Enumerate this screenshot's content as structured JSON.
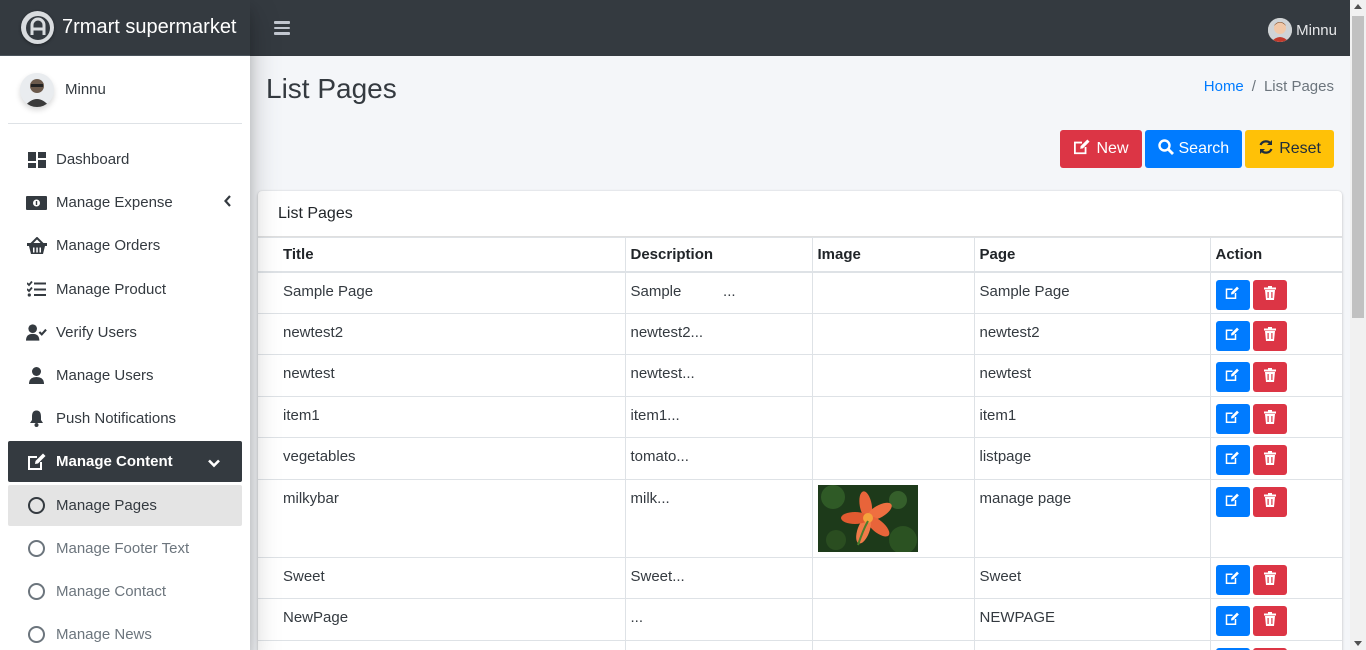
{
  "brand": {
    "name": "7rmart supermarket",
    "logo_icon": "app-logo-icon"
  },
  "sidebar": {
    "user_name": "Minnu",
    "items": [
      {
        "label": "Dashboard",
        "icon": "dashboard-icon"
      },
      {
        "label": "Manage Expense",
        "icon": "money-icon"
      },
      {
        "label": "Manage Orders",
        "icon": "basket-icon"
      },
      {
        "label": "Manage Product",
        "icon": "tasks-icon"
      },
      {
        "label": "Verify Users",
        "icon": "user-check-icon"
      },
      {
        "label": "Manage Users",
        "icon": "user-icon"
      },
      {
        "label": "Push Notifications",
        "icon": "bell-icon"
      },
      {
        "label": "Manage Content",
        "icon": "edit-icon"
      },
      {
        "label": "Manage Pages",
        "icon": "circle-icon"
      },
      {
        "label": "Manage Footer Text",
        "icon": "circle-icon"
      },
      {
        "label": "Manage Contact",
        "icon": "circle-icon"
      },
      {
        "label": "Manage News",
        "icon": "circle-icon"
      }
    ]
  },
  "topbar": {
    "user_name": "Minnu"
  },
  "page": {
    "title": "List Pages",
    "breadcrumb": {
      "home": "Home",
      "separator": "/",
      "current": "List Pages"
    }
  },
  "buttons": {
    "new": "New",
    "search": "Search",
    "reset": "Reset"
  },
  "card": {
    "title": "List Pages",
    "columns": [
      "Title",
      "Description",
      "Image",
      "Page",
      "Action"
    ],
    "rows": [
      {
        "title": "Sample Page",
        "description": "Sample          ...",
        "image": "",
        "page": "Sample Page"
      },
      {
        "title": "newtest2",
        "description": "newtest2...",
        "image": "",
        "page": "newtest2"
      },
      {
        "title": "newtest",
        "description": "newtest...",
        "image": "",
        "page": "newtest"
      },
      {
        "title": "item1",
        "description": "item1...",
        "image": "",
        "page": "item1"
      },
      {
        "title": "vegetables",
        "description": "tomato...",
        "image": "",
        "page": "listpage"
      },
      {
        "title": "milkybar",
        "description": "milk...",
        "image": "flower-thumbnail",
        "page": "manage page"
      },
      {
        "title": "Sweet",
        "description": "Sweet...",
        "image": "",
        "page": "Sweet"
      },
      {
        "title": "NewPage",
        "description": "...",
        "image": "",
        "page": "NEWPAGE"
      }
    ]
  },
  "colors": {
    "dark": "#343a40",
    "primary": "#007bff",
    "danger": "#dc3545",
    "warning": "#ffc107"
  }
}
